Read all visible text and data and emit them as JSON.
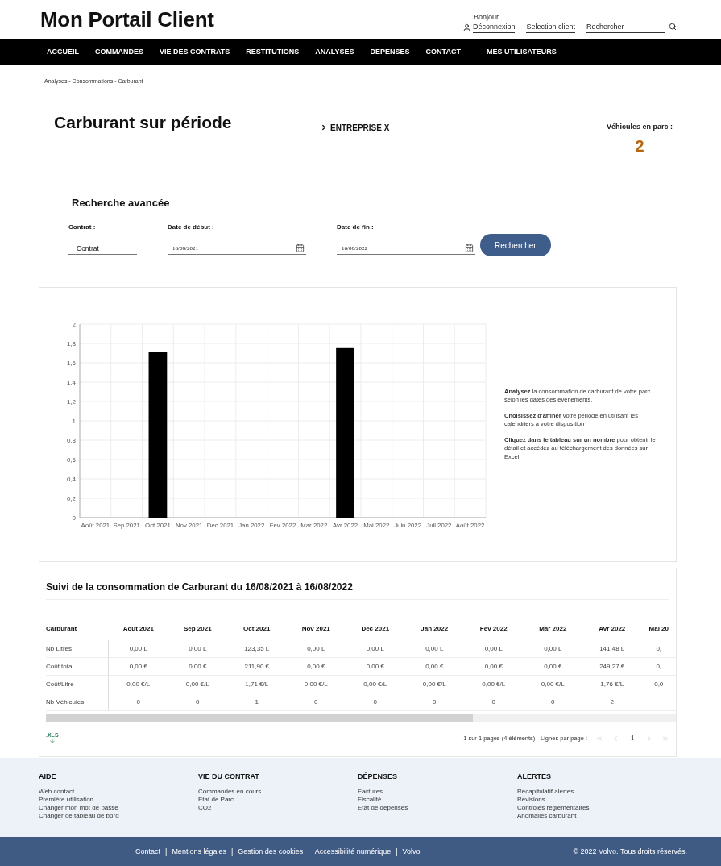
{
  "header": {
    "logo": "Mon Portail Client",
    "greeting": "Bonjour",
    "logout": "Déconnexion",
    "client_select": "Selection client",
    "search": {
      "placeholder": "Rechercher"
    }
  },
  "nav": [
    "ACCUEIL",
    "COMMANDES",
    "VIE DES CONTRATS",
    "RESTITUTIONS",
    "ANALYSES",
    "DÉPENSES",
    "CONTACT",
    "MES UTILISATEURS"
  ],
  "breadcrumb": "Analyses - Consommations - Carburant",
  "page": {
    "title": "Carburant sur période",
    "company": "ENTREPRISE X",
    "fleet_label": "Véhicules en parc :",
    "fleet_count": "2"
  },
  "search_form": {
    "title": "Recherche avancée",
    "fields": [
      {
        "label": "Contrat :",
        "value": "Contrat",
        "kind": "search"
      },
      {
        "label": "Date de début :",
        "value": "16/08/2021",
        "kind": "date"
      },
      {
        "label": "Date de fin :",
        "value": "16/08/2022",
        "kind": "date"
      }
    ],
    "button": "Rechercher"
  },
  "chart_panel": {
    "chart_data": {
      "type": "bar",
      "categories": [
        "Août 2021",
        "Sep 2021",
        "Oct 2021",
        "Nov 2021",
        "Dec 2021",
        "Jan 2022",
        "Fev 2022",
        "Mar 2022",
        "Avr 2022",
        "Mai 2022",
        "Juin 2022",
        "Juil 2022",
        "Août 2022"
      ],
      "values": [
        0,
        0,
        1.71,
        0,
        0,
        0,
        0,
        0,
        1.76,
        0,
        0,
        0,
        0
      ],
      "grid": true,
      "ylim": [
        0,
        2
      ],
      "yticks": [
        0,
        {
          "value": 0.2,
          "label": "0,2"
        },
        {
          "value": 0.4,
          "label": "0,4"
        },
        {
          "value": 0.6,
          "label": "0,6"
        },
        {
          "value": 0.8,
          "label": "0,8"
        },
        1,
        {
          "value": 1.2,
          "label": "1,2"
        },
        {
          "value": 1.4,
          "label": "1,4"
        },
        {
          "value": 1.6,
          "label": "1,6"
        },
        {
          "value": 1.8,
          "label": "1,8"
        },
        2
      ]
    },
    "help": [
      "**Analysez** la consommation de carburant de votre parc selon les dates des événements.",
      "**Choisissez d'affiner** votre période en utilisant les calendriers à votre disposition",
      "**Cliquez dans le tableau sur un nombre** pour obtenir le détail et accédez au téléchargement des données sur Excel."
    ]
  },
  "table": {
    "title": "Suivi de la consommation de Carburant du 16/08/2021 à 16/08/2022",
    "columns": [
      "Carburant",
      "Août 2021",
      "Sep 2021",
      "Oct 2021",
      "Nov 2021",
      "Dec 2021",
      "Jan 2022",
      "Fev 2022",
      "Mar 2022",
      "Avr 2022",
      "Mai 20"
    ],
    "rows": [
      [
        "Nb Litres",
        "0,00 L",
        "0,00 L",
        "123,35 L",
        "0,00 L",
        "0,00 L",
        "0,00 L",
        "0,00 L",
        "0,00 L",
        "141,48 L",
        "0,"
      ],
      [
        "Coût total",
        "0,00 €",
        "0,00 €",
        "211,90 €",
        "0,00 €",
        "0,00 €",
        "0,00 €",
        "0,00 €",
        "0,00 €",
        "249,27 €",
        "0,"
      ],
      [
        "Coût/Litre",
        "0,00 €/L",
        "0,00 €/L",
        "1,71 €/L",
        "0,00 €/L",
        "0,00 €/L",
        "0,00 €/L",
        "0,00 €/L",
        "0,00 €/L",
        "1,76 €/L",
        "0,0"
      ],
      [
        "Nb Véhicules",
        "0",
        "0",
        "1",
        "0",
        "0",
        "0",
        "0",
        "0",
        "2"
      ]
    ],
    "export": ".XLS",
    "pager_summary": "1 sur 1 pages (4 éléments) - Lignes par page :",
    "pages": [
      {
        "label": "1",
        "selected": true
      }
    ],
    "nav_disabled": true
  },
  "footer": {
    "columns": [
      {
        "title": "AIDE",
        "links": [
          "Web contact",
          "Première utilisation",
          "Changer mon mot de passe",
          "Changer de tableau de bord"
        ]
      },
      {
        "title": "VIE DU CONTRAT",
        "links": [
          "Commandes en cours",
          "Etat de Parc",
          "CO2"
        ]
      },
      {
        "title": "DÉPENSES",
        "links": [
          "Factures",
          "Fiscalité",
          "Etat de dépenses"
        ]
      },
      {
        "title": "ALERTES",
        "links": [
          "Récapitulatif alertes",
          "Révisions",
          "Contrôles réglementaires",
          "Anomalies carburant"
        ]
      }
    ],
    "separator": "|",
    "bottom_links": [
      "Contact",
      "Mentions légales",
      "Gestion des cookies",
      "Accessibilité numérique",
      "Volvo"
    ],
    "copyright": "© 2022 Volvo. Tous droits réservés."
  }
}
